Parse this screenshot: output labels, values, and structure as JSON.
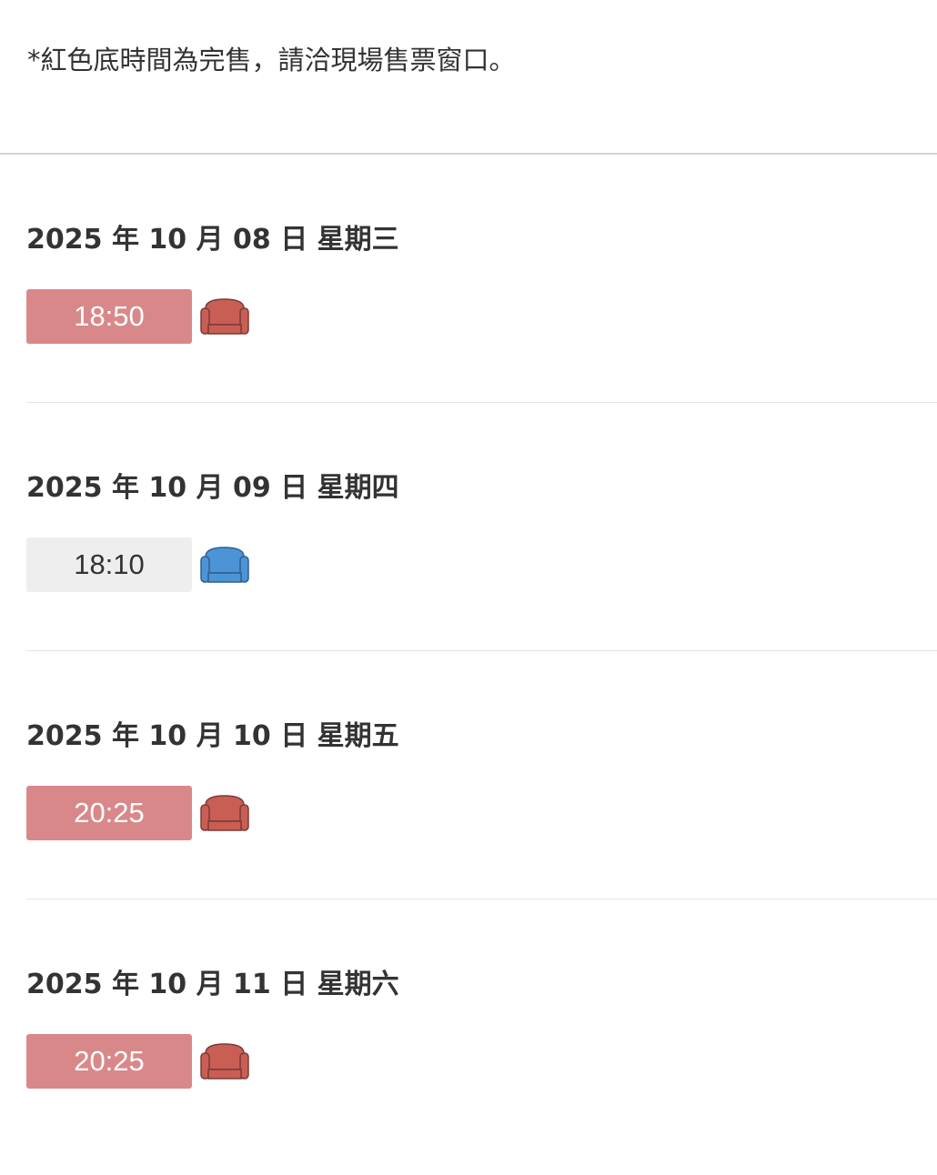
{
  "notice": "*紅色底時間為完售，請洽現場售票窗口。",
  "colors": {
    "sold_out_bg": "#d9888a",
    "sold_out_seat": "#c95e55",
    "available_bg": "#eeeeee",
    "available_seat": "#4c94d6"
  },
  "days": [
    {
      "date": "2025 年 10 月 08 日 星期三",
      "showtimes": [
        {
          "time": "18:50",
          "status": "sold-out",
          "icon": "seat-icon"
        }
      ]
    },
    {
      "date": "2025 年 10 月 09 日 星期四",
      "showtimes": [
        {
          "time": "18:10",
          "status": "available",
          "icon": "seat-icon"
        }
      ]
    },
    {
      "date": "2025 年 10 月 10 日 星期五",
      "showtimes": [
        {
          "time": "20:25",
          "status": "sold-out",
          "icon": "seat-icon"
        }
      ]
    },
    {
      "date": "2025 年 10 月 11 日 星期六",
      "showtimes": [
        {
          "time": "20:25",
          "status": "sold-out",
          "icon": "seat-icon"
        }
      ]
    }
  ]
}
